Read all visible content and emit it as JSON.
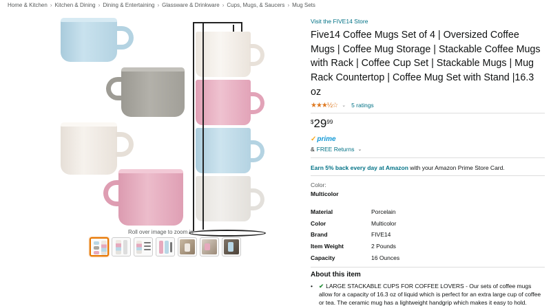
{
  "breadcrumb": [
    "Home & Kitchen",
    "Kitchen & Dining",
    "Dining & Entertaining",
    "Glassware & Drinkware",
    "Cups, Mugs, & Saucers",
    "Mug Sets"
  ],
  "gallery": {
    "zoom_hint": "Roll over image to zoom in",
    "thumbnail_count": 7,
    "active_thumbnail": 1
  },
  "product": {
    "store_link": "Visit the FIVE14 Store",
    "title": "Five14 Coffee Mugs Set of 4 | Oversized Coffee Mugs | Coffee Mug Storage | Stackable Coffee Mugs with Rack | Coffee Cup Set | Stackable Mugs | Mug Rack Countertop | Coffee Mug Set with Stand |16.3 oz",
    "rating_stars": 3.5,
    "ratings_text": "5 ratings",
    "price": {
      "symbol": "$",
      "whole": "29",
      "fraction": "99"
    },
    "prime_label": "prime",
    "returns_amp": "&",
    "returns_label": "FREE Returns",
    "promo_bold": "Earn 5% back every day at Amazon",
    "promo_rest": " with your Amazon Prime Store Card.",
    "color_label": "Color:",
    "color_value": "Multicolor",
    "specs": [
      {
        "key": "Material",
        "value": "Porcelain"
      },
      {
        "key": "Color",
        "value": "Multicolor"
      },
      {
        "key": "Brand",
        "value": "FIVE14"
      },
      {
        "key": "Item Weight",
        "value": "2 Pounds"
      },
      {
        "key": "Capacity",
        "value": "16 Ounces"
      }
    ],
    "about_title": "About this item",
    "bullet_1": "LARGE STACKABLE CUPS FOR COFFEE LOVERS - Our sets of coffee mugs allow for a capacity of 16.3 oz of liquid which is perfect for an extra large cup of coffee or tea. The ceramic mug has a lightweight handgrip which makes it easy to hold. Stacked cups are suitable for coffee, lattes, cappuccinos,"
  },
  "colors": {
    "blue": "#b9d7e6",
    "gray": "#a8a69f",
    "cream": "#efe9e2",
    "pink": "#e6a9bd",
    "link": "#007185",
    "star": "#de7921",
    "prime": "#1399d6"
  }
}
